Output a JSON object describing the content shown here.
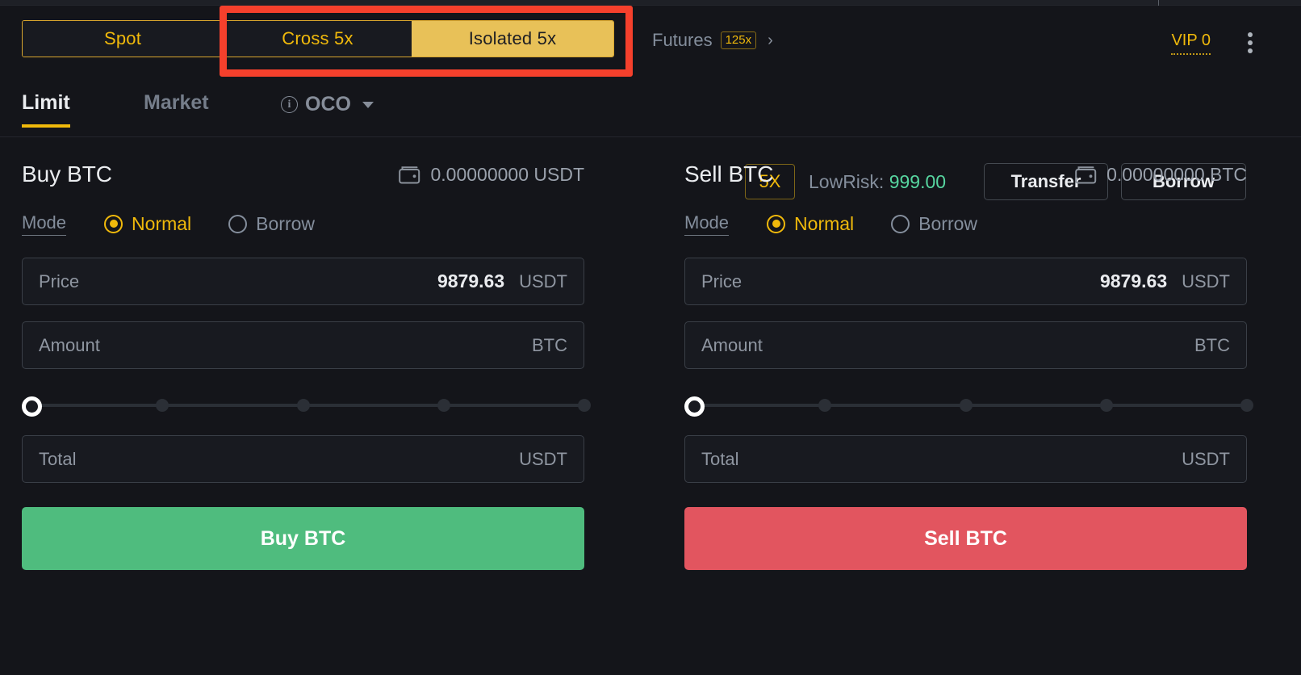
{
  "header": {
    "margin_tabs": [
      {
        "label": "Spot",
        "state": "inactive"
      },
      {
        "label": "Cross 5x",
        "state": "inactive"
      },
      {
        "label": "Isolated 5x",
        "state": "active"
      }
    ],
    "futures_label": "Futures",
    "futures_badge": "125x",
    "futures_chevron": "chevron-right-icon",
    "vip_label": "VIP 0",
    "more_menu": "kebab-menu-icon",
    "annotation": {
      "color": "#f5402c",
      "shape": "rectangle"
    }
  },
  "order_tabs": {
    "items": [
      {
        "label": "Limit",
        "state": "active"
      },
      {
        "label": "Market",
        "state": "inactive"
      },
      {
        "label": "OCO",
        "state": "inactive"
      }
    ],
    "oco_info_icon": "info-icon",
    "oco_caret": "chevron-down-icon"
  },
  "account_bar": {
    "leverage": "5X",
    "risk_label": "LowRisk:",
    "risk_value": "999.00",
    "risk_color": "#57d6a0",
    "transfer_label": "Transfer",
    "borrow_label": "Borrow"
  },
  "buy_panel": {
    "title": "Buy BTC",
    "wallet_icon": "wallet-icon",
    "balance": "0.00000000 USDT",
    "mode_label": "Mode",
    "mode_options": [
      {
        "label": "Normal",
        "selected": true
      },
      {
        "label": "Borrow",
        "selected": false
      }
    ],
    "price": {
      "label": "Price",
      "value": "9879.63",
      "unit": "USDT"
    },
    "amount": {
      "label": "Amount",
      "value": "",
      "unit": "BTC"
    },
    "total": {
      "label": "Total",
      "value": "",
      "unit": "USDT"
    },
    "slider": {
      "value": 0,
      "ticks": [
        0,
        25,
        50,
        75,
        100
      ]
    },
    "submit_label": "Buy BTC",
    "submit_color": "#4fbc7e"
  },
  "sell_panel": {
    "title": "Sell BTC",
    "wallet_icon": "wallet-icon",
    "balance": "0.00000000 BTC",
    "mode_label": "Mode",
    "mode_options": [
      {
        "label": "Normal",
        "selected": true
      },
      {
        "label": "Borrow",
        "selected": false
      }
    ],
    "price": {
      "label": "Price",
      "value": "9879.63",
      "unit": "USDT"
    },
    "amount": {
      "label": "Amount",
      "value": "",
      "unit": "BTC"
    },
    "total": {
      "label": "Total",
      "value": "",
      "unit": "USDT"
    },
    "slider": {
      "value": 0,
      "ticks": [
        0,
        25,
        50,
        75,
        100
      ]
    },
    "submit_label": "Sell BTC",
    "submit_color": "#e2555f"
  }
}
